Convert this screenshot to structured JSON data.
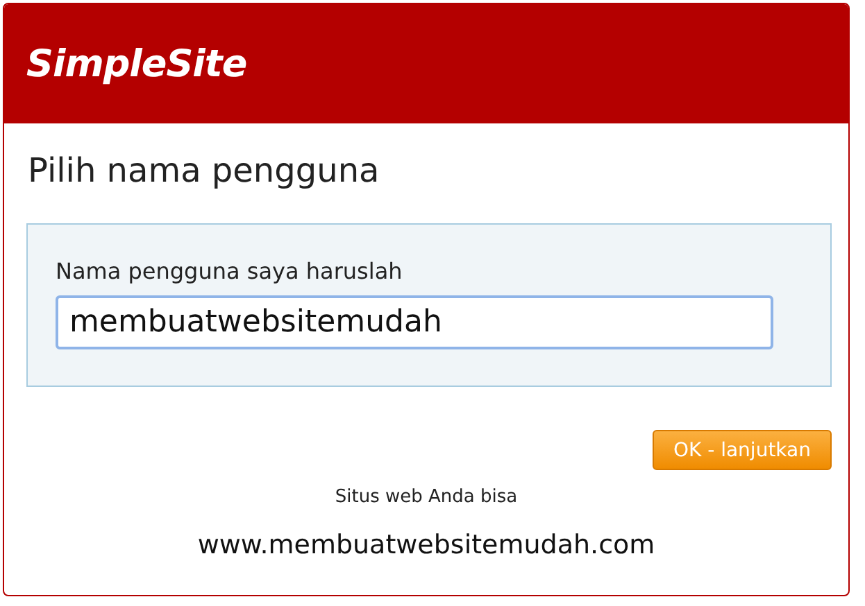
{
  "header": {
    "logo": "SimpleSite"
  },
  "title": "Pilih nama pengguna",
  "form": {
    "label": "Nama pengguna saya haruslah",
    "value": "membuatwebsitemudah"
  },
  "button": "OK - lanjutkan",
  "note": "Situs web Anda bisa",
  "url": "www.membuatwebsitemudah.com"
}
